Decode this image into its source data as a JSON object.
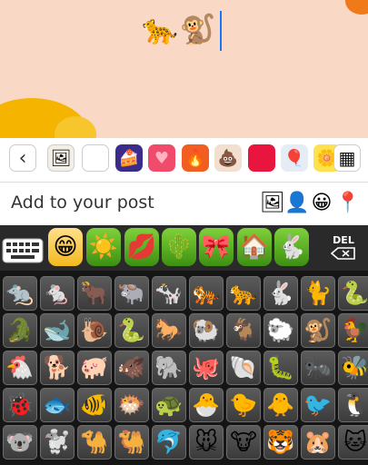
{
  "composer": {
    "text": "🐆🐒",
    "add_to_post_label": "Add to your post"
  },
  "colors": {
    "canvas_bg": "#f9d8c6",
    "flower_yellow": "#f5b400",
    "flower_orange": "#f07a1a",
    "caret": "#1877f2",
    "key_bg": "#4a4a4a",
    "category_green": "#5cb224"
  },
  "background_strip": {
    "items": [
      {
        "name": "back-chevron-icon",
        "glyph": "‹"
      },
      {
        "name": "bg-drawing",
        "glyph": "🖼"
      },
      {
        "name": "bg-white",
        "glyph": ""
      },
      {
        "name": "bg-cake",
        "glyph": "🍰"
      },
      {
        "name": "bg-heart",
        "glyph": "♥"
      },
      {
        "name": "bg-fire",
        "glyph": "🔥"
      },
      {
        "name": "bg-poop",
        "glyph": "💩"
      },
      {
        "name": "bg-red",
        "glyph": ""
      },
      {
        "name": "bg-balloons",
        "glyph": "🎈"
      },
      {
        "name": "bg-flower",
        "glyph": "🌼"
      },
      {
        "name": "grid-icon",
        "glyph": "▦"
      }
    ]
  },
  "add_icons": [
    {
      "name": "photo-icon",
      "glyph": "🖼"
    },
    {
      "name": "tag-people-icon",
      "glyph": "👤"
    },
    {
      "name": "feeling-icon",
      "glyph": "😀"
    },
    {
      "name": "location-pin-icon",
      "glyph": "📍"
    }
  ],
  "keyboard": {
    "del_label": "DEL",
    "categories": [
      {
        "name": "smileys",
        "glyph": "😁"
      },
      {
        "name": "sun",
        "glyph": "☀️"
      },
      {
        "name": "lips",
        "glyph": "💋"
      },
      {
        "name": "cactus",
        "glyph": "🌵"
      },
      {
        "name": "ribbon",
        "glyph": "🎀"
      },
      {
        "name": "house",
        "glyph": "🏠"
      },
      {
        "name": "rabbit",
        "glyph": "🐇"
      }
    ],
    "emoji_grid": [
      "🐀",
      "🐁",
      "🐂",
      "🐃",
      "🐄",
      "🐅",
      "🐆",
      "🐇",
      "🐈",
      "🐍",
      "🐊",
      "🐋",
      "🐌",
      "🐍",
      "🐎",
      "🐏",
      "🐐",
      "🐑",
      "🐒",
      "🐓",
      "🐔",
      "🐕",
      "🐖",
      "🐗",
      "🐘",
      "🐙",
      "🐚",
      "🐛",
      "🐜",
      "🐝",
      "🐞",
      "🐟",
      "🐠",
      "🐡",
      "🐢",
      "🐣",
      "🐤",
      "🐥",
      "🐦",
      "🐧",
      "🐨",
      "🐩",
      "🐪",
      "🐫",
      "🐬",
      "🐭",
      "🐮",
      "🐯",
      "🐹",
      "🐱"
    ]
  }
}
